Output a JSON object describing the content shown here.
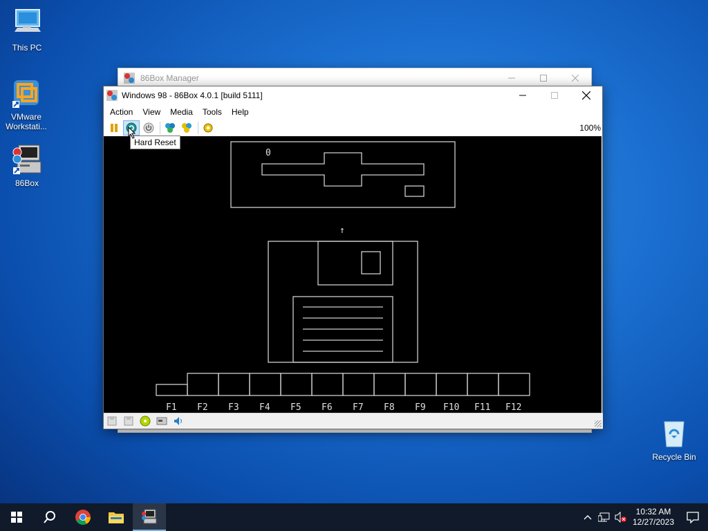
{
  "desktop": {
    "icons": [
      {
        "label": "This PC",
        "icon": "computer-icon"
      },
      {
        "label": "VMware Workstati...",
        "icon": "vmware-icon"
      },
      {
        "label": "86Box",
        "icon": "86box-icon"
      },
      {
        "label": "Recycle Bin",
        "icon": "recycle-bin-icon"
      }
    ]
  },
  "manager_window": {
    "title": "86Box Manager"
  },
  "main_window": {
    "title": "Windows 98 - 86Box 4.0.1 [build 5111]",
    "menu": [
      "Action",
      "View",
      "Media",
      "Tools",
      "Help"
    ],
    "toolbar": {
      "buttons": [
        {
          "icon": "pause-icon"
        },
        {
          "icon": "hard-reset-icon"
        },
        {
          "icon": "power-icon"
        },
        {
          "icon": "ctrl-alt-del-icon"
        },
        {
          "icon": "ctrl-alt-esc-icon"
        },
        {
          "icon": "settings-icon"
        }
      ],
      "zoom": "100%"
    },
    "tooltip": "Hard Reset",
    "screen": {
      "digit": "0",
      "arrow": "↑",
      "fkeys": [
        "F1",
        "F2",
        "F3",
        "F4",
        "F5",
        "F6",
        "F7",
        "F8",
        "F9",
        "F10",
        "F11",
        "F12"
      ]
    },
    "status_icons": [
      "floppy-icon",
      "floppy-icon",
      "cdrom-icon",
      "hdd-icon",
      "sound-icon"
    ]
  },
  "taskbar": {
    "items": [
      "windows-start-icon",
      "search-icon",
      "chrome-icon",
      "file-explorer-icon",
      "86box-icon"
    ],
    "tray_icons": [
      "chevron-up-icon",
      "network-icon",
      "volume-muted-icon"
    ],
    "time": "10:32 AM",
    "date": "12/27/2023"
  },
  "colors": {
    "desktop_accent": "#1b6fd0",
    "taskbar": "#101a2a",
    "screen": "#000000"
  }
}
